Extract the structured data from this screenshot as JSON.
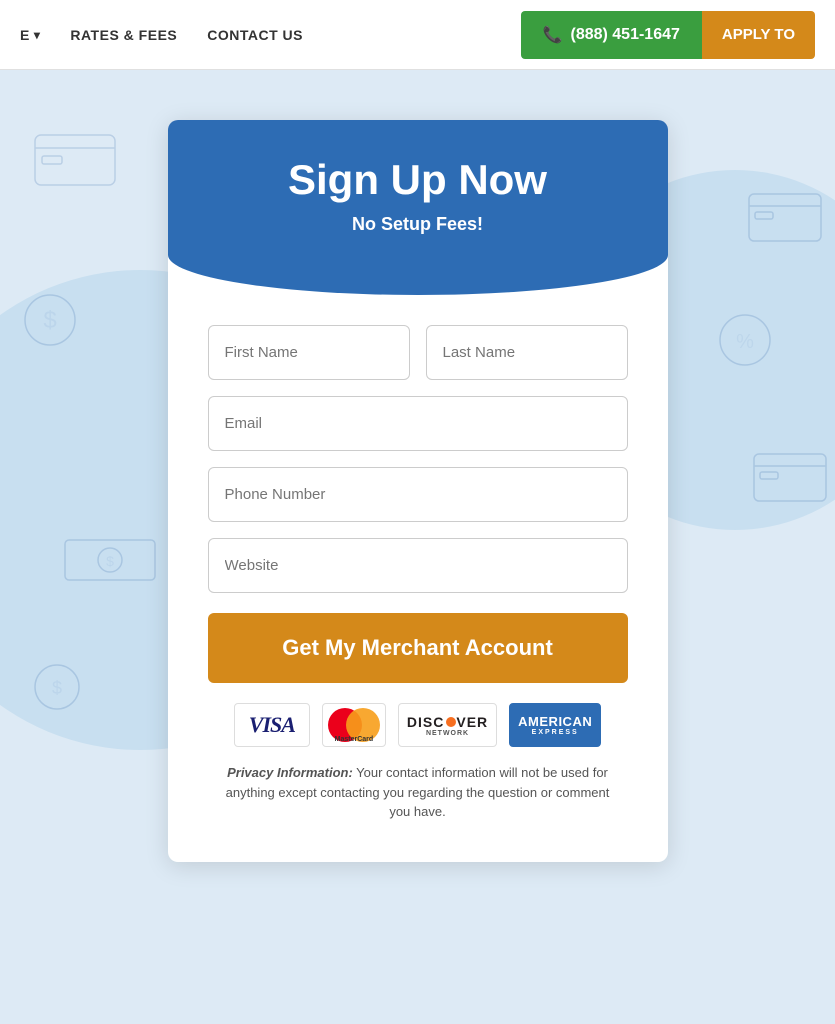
{
  "nav": {
    "item1_label": "E",
    "item2_label": "RATES & FEES",
    "item3_label": "CONTACT US",
    "phone_label": "(888) 451-1647",
    "apply_label": "APPLY TO"
  },
  "form": {
    "title": "Sign Up Now",
    "subtitle": "No Setup Fees!",
    "first_name_placeholder": "First Name",
    "last_name_placeholder": "Last Name",
    "email_placeholder": "Email",
    "phone_placeholder": "Phone Number",
    "website_placeholder": "Website",
    "submit_label": "Get My Merchant Account"
  },
  "privacy": {
    "bold": "Privacy Information:",
    "text": " Your contact information will not be used for anything except contacting you regarding the question or comment you have."
  },
  "cards": {
    "visa": "VISA",
    "mastercard": "MasterCard",
    "discover": "DISCOVER",
    "amex": "AMERICAN EXPRESS"
  }
}
